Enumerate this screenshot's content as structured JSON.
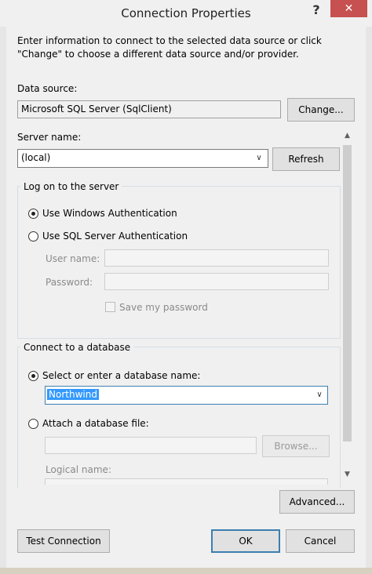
{
  "window": {
    "title": "Connection Properties",
    "help_label": "?",
    "close_label": "✕"
  },
  "instructions": "Enter information to connect to the selected data source or click \"Change\" to choose a different data source and/or provider.",
  "data_source": {
    "label": "Data source:",
    "value": "Microsoft SQL Server (SqlClient)",
    "change_label": "Change..."
  },
  "server": {
    "label": "Server name:",
    "value": "(local)",
    "refresh_label": "Refresh"
  },
  "logon": {
    "group_title": "Log on to the server",
    "windows_auth_label": "Use Windows Authentication",
    "sql_auth_label": "Use SQL Server Authentication",
    "selected": "windows",
    "username_label": "User name:",
    "username_value": "",
    "password_label": "Password:",
    "password_value": "",
    "save_password_label": "Save my password",
    "save_password_checked": false
  },
  "database": {
    "group_title": "Connect to a database",
    "select_label": "Select or enter a database name:",
    "select_value": "Northwind",
    "attach_label": "Attach a database file:",
    "attach_value": "",
    "browse_label": "Browse...",
    "logical_name_label": "Logical name:",
    "selected": "select"
  },
  "buttons": {
    "advanced": "Advanced...",
    "test_connection": "Test Connection",
    "ok": "OK",
    "cancel": "Cancel"
  },
  "icons": {
    "dropdown": "chevron-down-icon",
    "scroll_up": "scroll-up-icon",
    "scroll_down": "scroll-down-icon"
  }
}
